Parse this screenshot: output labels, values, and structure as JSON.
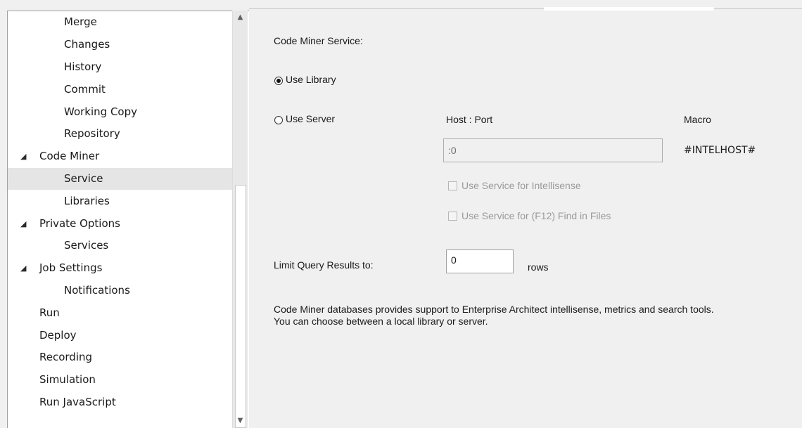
{
  "tree": {
    "items": [
      {
        "label": "Merge"
      },
      {
        "label": "Changes"
      },
      {
        "label": "History"
      },
      {
        "label": "Commit"
      },
      {
        "label": "Working Copy"
      },
      {
        "label": "Repository"
      },
      {
        "label": "Code Miner",
        "expanded": true
      },
      {
        "label": "Service",
        "selected": true
      },
      {
        "label": "Libraries"
      },
      {
        "label": "Private Options",
        "expanded": true
      },
      {
        "label": "Services"
      },
      {
        "label": "Job Settings",
        "expanded": true
      },
      {
        "label": "Notifications"
      },
      {
        "label": "Run"
      },
      {
        "label": "Deploy"
      },
      {
        "label": "Recording"
      },
      {
        "label": "Simulation"
      },
      {
        "label": "Run JavaScript"
      }
    ],
    "expanded_glyph": "◢"
  },
  "scrollbar": {
    "up_glyph": "▲",
    "down_glyph": "▼"
  },
  "service": {
    "heading": "Code Miner Service:",
    "use_library_label": "Use Library",
    "use_server_label": "Use Server",
    "host_port_label": "Host : Port",
    "host_port_value": ":0",
    "macro_label": "Macro",
    "macro_value": "#INTELHOST#",
    "intellisense_label": "Use Service for Intellisense",
    "find_in_files_label": "Use Service for (F12) Find in Files",
    "selected_mode": "Use Library"
  },
  "limit": {
    "label": "Limit Query Results to:",
    "value": "0",
    "unit": "rows"
  },
  "description": {
    "line1": "Code Miner databases provides support to Enterprise Architect intellisense, metrics and search tools.",
    "line2": "You can choose between a local library or server."
  }
}
